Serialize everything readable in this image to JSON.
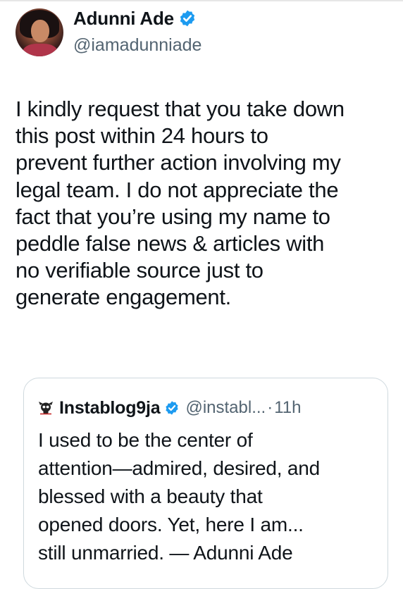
{
  "post": {
    "author": {
      "display_name": "Adunni Ade",
      "handle": "@iamadunniade",
      "verified": true,
      "verified_color": "#1d9bf0"
    },
    "body_lines": [
      "I kindly request that you take down",
      "this post within 24 hours to",
      "prevent further action involving my",
      "legal team. I do not appreciate the",
      "fact that you’re using my name to",
      "peddle false news & articles with",
      "no verifiable source just to",
      "generate engagement."
    ]
  },
  "quoted_post": {
    "logo_icon": "skull-logo-icon",
    "display_name": "Instablog9ja",
    "verified": true,
    "handle": "@instabl...",
    "separator": "·",
    "time": "11h",
    "body_lines": [
      "I used to be the center of",
      "attention—admired, desired, and",
      "blessed with a beauty that",
      "opened doors. Yet, here I am...",
      "still unmarried. — Adunni Ade"
    ]
  }
}
